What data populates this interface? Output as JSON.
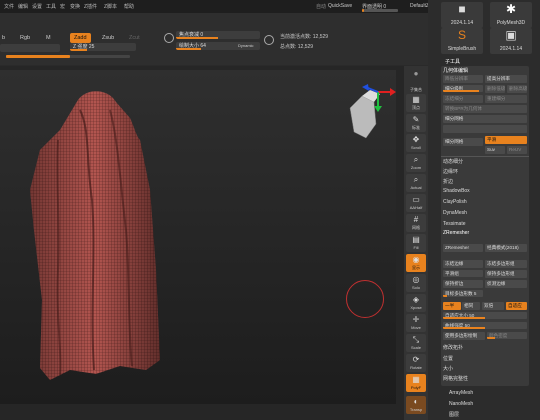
{
  "menu": [
    "文件",
    "编辑",
    "设置",
    "工具",
    "宏",
    "变换",
    "Z插件",
    "Z脚本",
    "帮助"
  ],
  "titlebar": {
    "autosave_label": "自动",
    "quicksave": "QuickSave",
    "see_through": "界面透明 0",
    "script": "DefaultZScript"
  },
  "toolbar": {
    "rgb_label": "Rgb",
    "m_label": "M",
    "rgb_intensity": "Rgb 强度",
    "zadd": "Zadd",
    "zsub": "Zsub",
    "zcut": "Zcut",
    "z_intensity": "Z 强度 25",
    "focal_shift": "焦点衰减 0",
    "draw_size": "绘制大小 64",
    "dynamic": "Dynamic",
    "active_points": "当前激活点数: 12,529",
    "total_points": "总点数: 12,529"
  },
  "brushes": [
    {
      "label": "2024.1.14"
    },
    {
      "label": "PolyMesh3D"
    },
    {
      "label": "SimpleBrush"
    },
    {
      "label": "2024.1.14"
    }
  ],
  "shelf": [
    {
      "label": "子集合"
    },
    {
      "label": "顶点"
    },
    {
      "label": "标准"
    },
    {
      "label": "Scroll"
    },
    {
      "label": "Zoom"
    },
    {
      "label": "Actual"
    },
    {
      "label": "AAHalf"
    },
    {
      "label": "网格"
    },
    {
      "label": "Fill"
    },
    {
      "label": "显示"
    },
    {
      "label": "Solo"
    },
    {
      "label": "Xpose"
    },
    {
      "label": "Move"
    },
    {
      "label": "Scale"
    },
    {
      "label": "Rotate"
    },
    {
      "label": "PolyF"
    },
    {
      "label": "Transp"
    }
  ],
  "panel": {
    "subtool": "子工具",
    "geometry": "几何体编辑",
    "lower_res": "降低分辨率",
    "higher_res": "提高分辨率",
    "sdiv": "细分级别",
    "del_lower": "删除低级",
    "del_higher": "删除高级",
    "freeze_subdiv": "冻结细分",
    "reconstruct": "重建细分",
    "convert_bpr": "转换BPR为几何体",
    "divide": "细分网格",
    "smt": "平滑",
    "suv": "Suv",
    "rel_uv": "ReUV",
    "dynamic_subdiv": "动态细分",
    "edge_loop": "边缘环",
    "crease": "折边",
    "shadowbox": "ShadowBox",
    "claypolish": "ClayPolish",
    "dynamesh": "DynaMesh",
    "tessimate": "Tessimate",
    "zremesher_header": "ZRemesher",
    "zremesher": "ZRemesher",
    "legacy": "经典模式(2018)",
    "freeze_border": "冻结边缘",
    "freeze_groups": "冻结多边形组",
    "smooth_groups": "平滑组",
    "keep_groups": "保持多边形组",
    "keep_creases": "保持折边",
    "detect_edges": "侦测边缘",
    "same": "一半",
    "double": "双倍",
    "adapt": "相同",
    "adaptive": "自适应",
    "target_count": "目标多边形数 5",
    "adaptive_size": "自适应大小 50",
    "curves_strength": "曲线强度 50",
    "use_polypaint": "使用多边形绘制",
    "color_density": "颜色密度",
    "modify_topology": "修改拓扑",
    "position": "位置",
    "size": "大小",
    "mesh_integrity": "网格完整性",
    "arraymesh": "ArrayMesh",
    "nanomesh": "NanoMesh",
    "layers": "图层"
  },
  "colors": {
    "accent": "#e8821e",
    "garment": "#b2554f",
    "gizmo_red": "#e02020",
    "gizmo_green": "#20c040",
    "gizmo_blue": "#2050e0"
  }
}
